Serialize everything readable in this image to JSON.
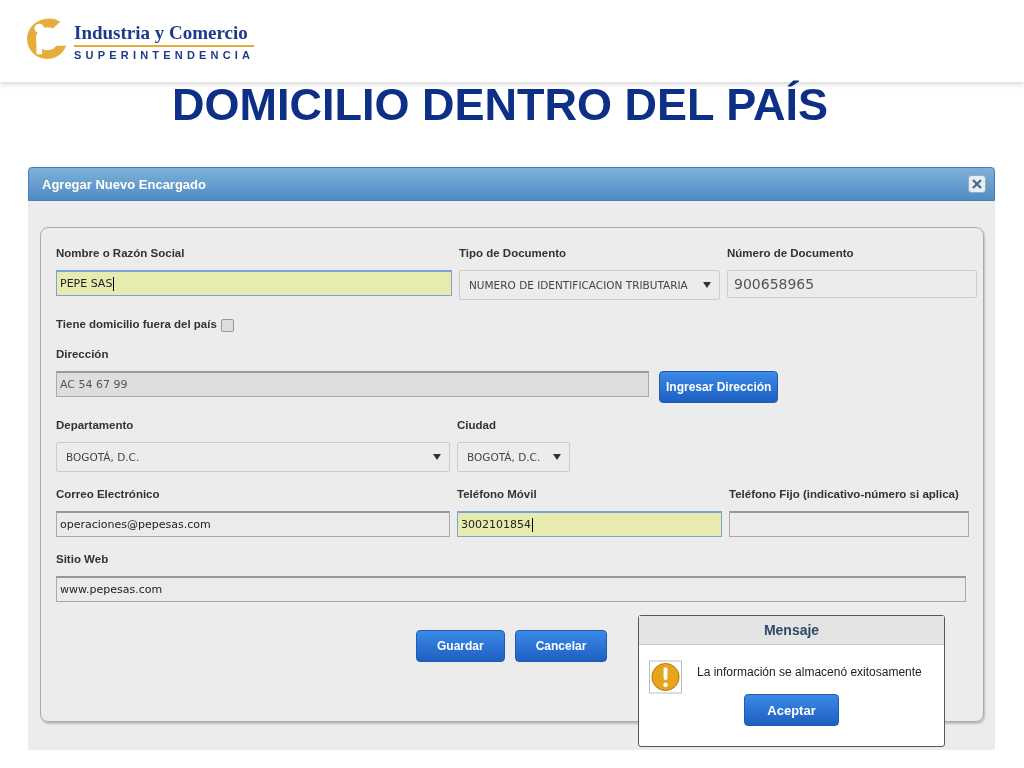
{
  "header": {
    "logo_title": "Industria y Comercio",
    "logo_subtitle": "SUPERINTENDENCIA"
  },
  "slide_title": "DOMICILIO DENTRO DEL PAÍS",
  "dialog": {
    "title": "Agregar Nuevo Encargado",
    "rows": [
      [
        {
          "kind": "text",
          "label": "Nombre o Razón Social",
          "value": "PEPE SAS",
          "highlighted": true,
          "disabled": false
        },
        {
          "kind": "select",
          "label": "Tipo de Documento",
          "value": "NUMERO DE IDENTIFICACION TRIBUTARIA"
        },
        {
          "kind": "text",
          "label": "Número de Documento",
          "value": "900658965",
          "highlighted": false
        }
      ],
      [
        {
          "kind": "checkbox",
          "label": "Tiene domicilio fuera del país",
          "checked": false
        }
      ],
      [
        {
          "kind": "text",
          "label": "Dirección",
          "value": "AC 54 67 99",
          "highlighted": false,
          "disabled": true,
          "action": "Ingresar Dirección"
        }
      ],
      [
        {
          "kind": "select",
          "label": "Departamento",
          "value": "BOGOTÁ, D.C."
        },
        {
          "kind": "select",
          "label": "Ciudad",
          "value": "BOGOTÁ, D.C."
        }
      ],
      [
        {
          "kind": "text",
          "label": "Correo Electrónico",
          "value": "operaciones@pepesas.com",
          "highlighted": false,
          "disabled": false
        },
        {
          "kind": "text",
          "label": "Teléfono Móvil",
          "value": "3002101854",
          "highlighted": true,
          "disabled": false
        },
        {
          "kind": "text",
          "label": "Teléfono Fijo (indicativo-número si aplica)",
          "highlighted": false,
          "disabled": false
        }
      ],
      [
        {
          "kind": "text",
          "label": "Sitio Web",
          "value": "www.pepesas.com",
          "highlighted": false,
          "disabled": false
        }
      ]
    ],
    "buttons": [
      "Guardar",
      "Cancelar"
    ]
  },
  "message": {
    "title": "Mensaje",
    "text": "La información se almacenó exitosamente",
    "button": "Aceptar"
  }
}
